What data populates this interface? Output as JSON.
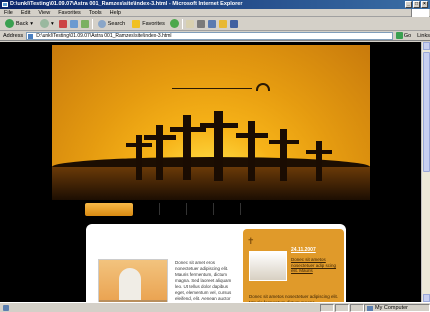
{
  "window": {
    "title": "D:\\unkl\\Testing\\01.09.07\\Astra 001_Ramzes\\site\\index-3.html - Microsoft Internet Explorer",
    "buttons": [
      "_",
      "□",
      "×"
    ]
  },
  "menu": [
    "File",
    "Edit",
    "View",
    "Favorites",
    "Tools",
    "Help"
  ],
  "toolbar": {
    "back": "Back",
    "search": "Search",
    "favorites": "Favorites"
  },
  "address": {
    "label": "Address",
    "value": "D:\\unkl\\Testing\\01.09.07\\Astra 001_Ramzes\\site\\index-3.html",
    "go": "Go",
    "links": "Links"
  },
  "content": {
    "left_text": "Donec sit amet eros nonectetuer adipiscing elit. Mauris fermentum, dictum magna. Sed laoreet aliquam leo. Ut tellus dolor dapibus eget, elementum vel, cursus eleifend, elit. Aenean auctor",
    "side": {
      "date": "24.11.2007",
      "text1": "Donec sit ametos nosectetuer adip scing elit. Mauris",
      "text2": "Donec sit ametos nosectetuer adipiscing elit. Mauris fermentum dictum magna."
    }
  },
  "status": {
    "zone": "My Computer"
  },
  "colors": {
    "accent": "#e09a2a",
    "titlebar": "#0a246a"
  }
}
